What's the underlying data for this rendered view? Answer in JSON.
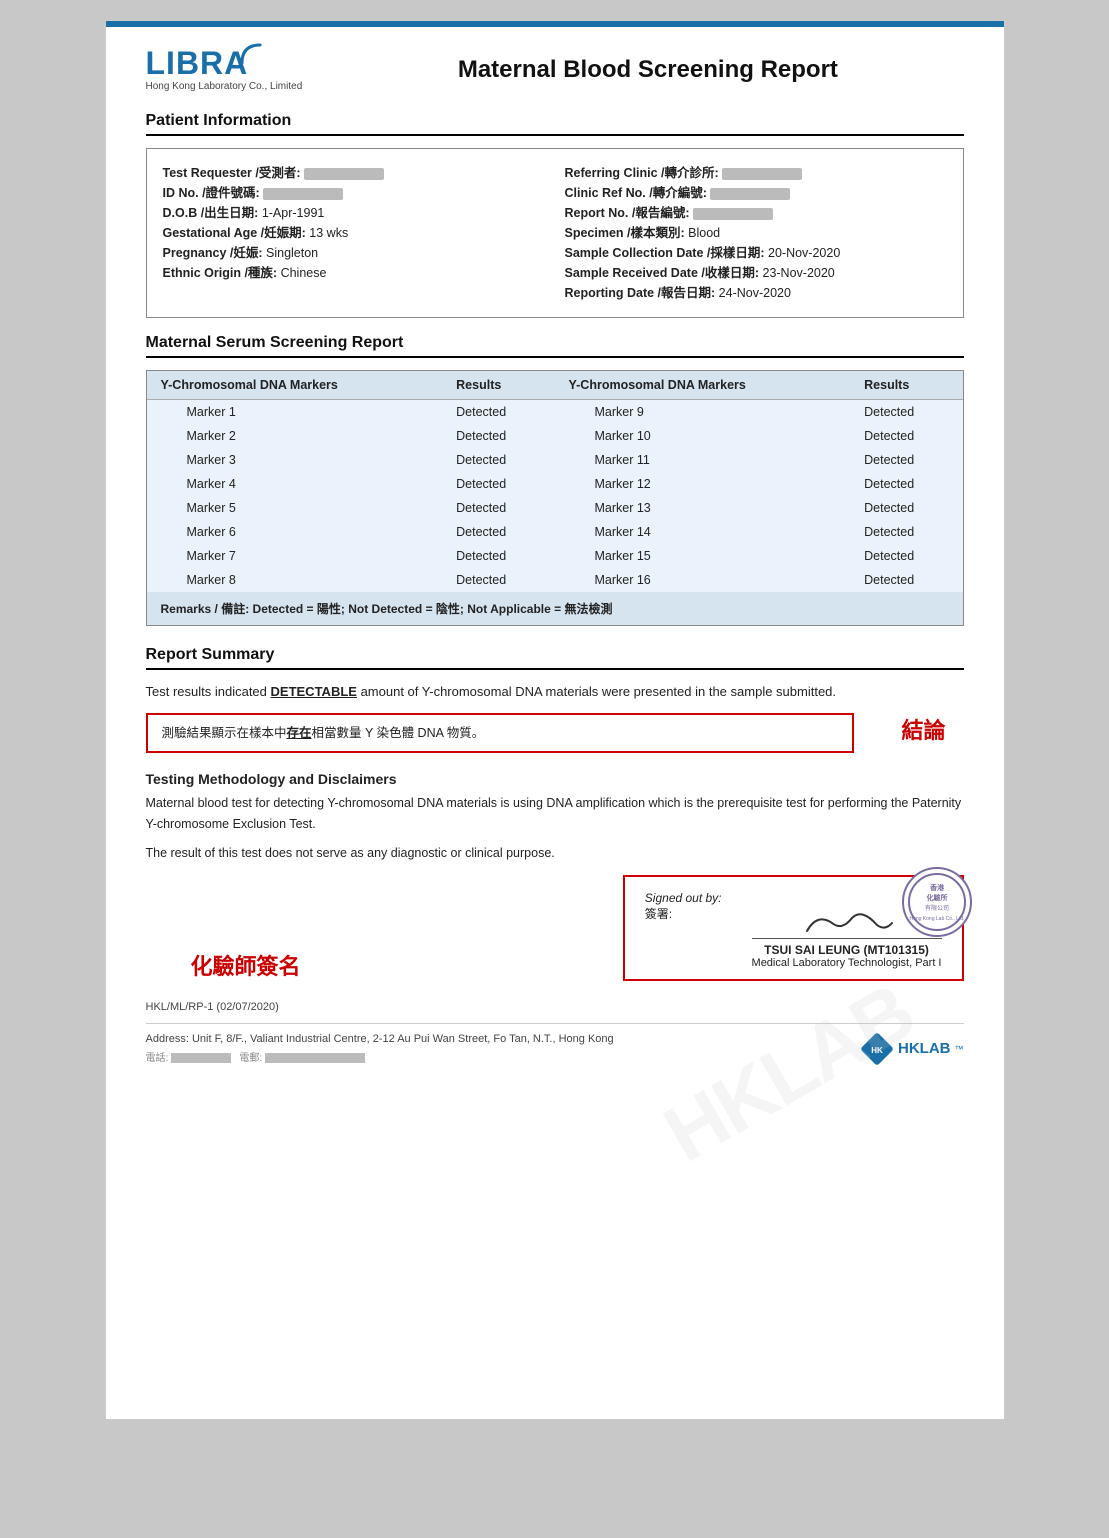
{
  "topBar": {},
  "header": {
    "logoLine1": "LIBRA",
    "logoSub": "Hong Kong Laboratory Co., Limited",
    "reportTitle": "Maternal Blood Screening Report"
  },
  "patientInfo": {
    "sectionTitle": "Patient Information",
    "leftFields": [
      {
        "label": "Test Requester /受測者:",
        "value": "blurred"
      },
      {
        "label": "ID No. /證件號碼:",
        "value": "blurred"
      },
      {
        "label": "D.O.B /出生日期:",
        "value": "1-Apr-1991"
      },
      {
        "label": "Gestational Age /妊娠期:",
        "value": "13 wks"
      },
      {
        "label": "Pregnancy /妊娠:",
        "value": "Singleton"
      },
      {
        "label": "Ethnic Origin /種族:",
        "value": "Chinese"
      }
    ],
    "rightFields": [
      {
        "label": "Referring Clinic /轉介診所:",
        "value": "blurred"
      },
      {
        "label": "Clinic Ref No. /轉介編號:",
        "value": "blurred"
      },
      {
        "label": "Report No. /報告編號:",
        "value": "blurred"
      },
      {
        "label": "Specimen /樣本類別:",
        "value": "Blood"
      },
      {
        "label": "Sample Collection Date /採樣日期:",
        "value": "20-Nov-2020"
      },
      {
        "label": "Sample Received Date /收樣日期:",
        "value": "23-Nov-2020"
      },
      {
        "label": "Reporting Date /報告日期:",
        "value": "24-Nov-2020"
      }
    ]
  },
  "serumSection": {
    "sectionTitle": "Maternal Serum Screening Report",
    "col1Header": "Y-Chromosomal DNA Markers",
    "col2Header": "Results",
    "col3Header": "Y-Chromosomal DNA Markers",
    "col4Header": "Results",
    "leftRows": [
      {
        "marker": "Marker 1",
        "result": "Detected"
      },
      {
        "marker": "Marker 2",
        "result": "Detected"
      },
      {
        "marker": "Marker 3",
        "result": "Detected"
      },
      {
        "marker": "Marker 4",
        "result": "Detected"
      },
      {
        "marker": "Marker 5",
        "result": "Detected"
      },
      {
        "marker": "Marker 6",
        "result": "Detected"
      },
      {
        "marker": "Marker 7",
        "result": "Detected"
      },
      {
        "marker": "Marker 8",
        "result": "Detected"
      }
    ],
    "rightRows": [
      {
        "marker": "Marker 9",
        "result": "Detected"
      },
      {
        "marker": "Marker 10",
        "result": "Detected"
      },
      {
        "marker": "Marker 11",
        "result": "Detected"
      },
      {
        "marker": "Marker 12",
        "result": "Detected"
      },
      {
        "marker": "Marker 13",
        "result": "Detected"
      },
      {
        "marker": "Marker 14",
        "result": "Detected"
      },
      {
        "marker": "Marker 15",
        "result": "Detected"
      },
      {
        "marker": "Marker 16",
        "result": "Detected"
      }
    ],
    "remarks": "Remarks / 備註: Detected = 陽性; Not Detected = 陰性; Not Applicable = 無法檢測"
  },
  "reportSummary": {
    "sectionTitle": "Report Summary",
    "summaryText1": "Test results indicated ",
    "summaryDetectable": "DETECTABLE",
    "summaryText2": " amount of Y-chromosomal DNA materials were presented in the sample submitted.",
    "boxLine1": "測驗結果顯示在樣本中",
    "boxBold": "存在",
    "boxLine2": "相當數量 Y 染色體 DNA 物質。",
    "conclusionLabel": "結論"
  },
  "methodology": {
    "title": "Testing Methodology and Disclaimers",
    "para1": "Maternal blood test for detecting Y-chromosomal DNA materials is using DNA amplification which is the prerequisite test for performing the Paternity Y-chromosome Exclusion Test.",
    "para2": "The result of this test does not serve as any diagnostic or clinical purpose."
  },
  "signature": {
    "chemistLabel": "化驗師簽名",
    "signedOutBy": "Signed out by:",
    "signedOutByChinese": "簽署:",
    "signerName": "TSUI SAI LEUNG (MT101315)",
    "signerTitle": "Medical Laboratory Technologist, Part I",
    "stampText": "香港\n化驗所\n有限公司"
  },
  "footer": {
    "code": "HKL/ML/RP-1 (02/07/2020)",
    "address": "Address: Unit F, 8/F., Valiant Industrial Centre, 2-12 Au Pui Wan Street, Fo Tan, N.T., Hong Kong",
    "phones": "電話: (blurred)   電郵: (blurred)",
    "hklabLabel": "HKLAB",
    "hklabTM": "™"
  }
}
